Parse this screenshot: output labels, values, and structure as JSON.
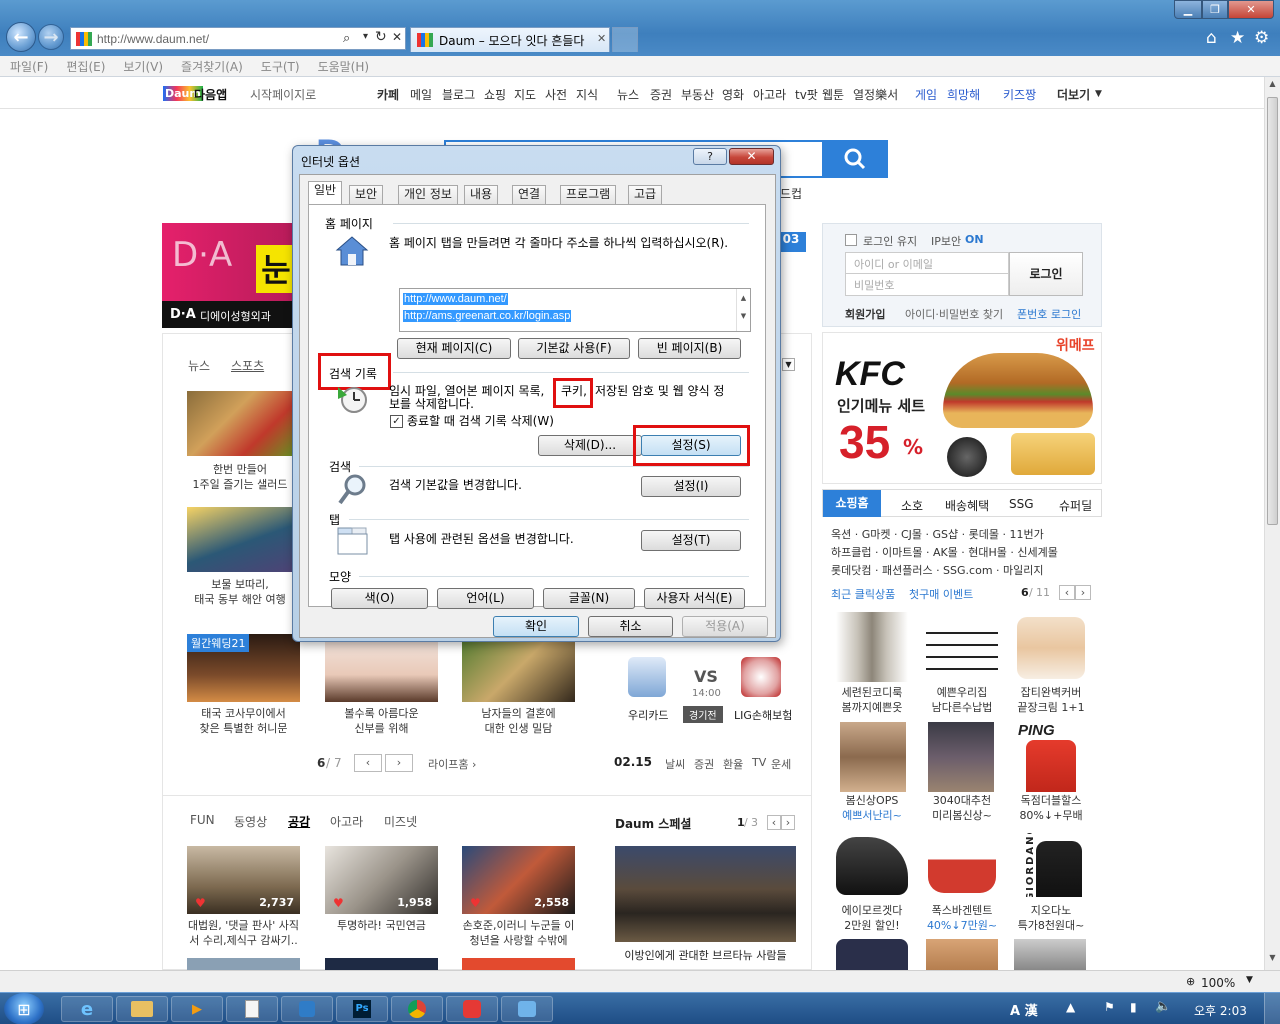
{
  "browser": {
    "address": "http://www.daum.net/",
    "tab_title": "Daum – 모으다 잇다 흔들다",
    "menu": [
      "파일(F)",
      "편집(E)",
      "보기(V)",
      "즐겨찾기(A)",
      "도구(T)",
      "도움말(H)"
    ],
    "zoom": "100%"
  },
  "gnb": {
    "logo": "Daum",
    "app": "다음앱",
    "startpage": "시작페이지로",
    "items": [
      "카페",
      "메일",
      "블로그",
      "쇼핑",
      "지도",
      "사전",
      "지식",
      "뉴스",
      "증권",
      "부동산",
      "영화",
      "아고라",
      "tv팟",
      "웹툰",
      "열정樂서"
    ],
    "items_blue": [
      "게임",
      "희망해",
      "키즈짱"
    ],
    "more": "더보기"
  },
  "login": {
    "keep": "로그인 유지",
    "ip": "IP보안",
    "ip_state": "ON",
    "id_placeholder": "아이디 or 이메일",
    "pw_placeholder": "비밀번호",
    "button": "로그인",
    "join": "회원가입",
    "find": "아이디·비밀번호 찾기",
    "phone": "폰번호 로그인"
  },
  "ad_da": {
    "logo": "D·A",
    "name": "디에이성형외과",
    "big": "눈"
  },
  "kfc": {
    "brand": "KFC",
    "line1": "인기메뉴 세트",
    "pct": "35",
    "pct_sign": "%",
    "we": "위메프"
  },
  "news_tabs": [
    "뉴스",
    "스포츠"
  ],
  "news_items": [
    {
      "cap1": "한번 만들어",
      "cap2": "1주일 즐기는 샐러드"
    },
    {
      "cap1": "보물 보따리,",
      "cap2": "태국 동부 해안 여행"
    },
    {
      "cap1": "태국 코사무이에서",
      "cap2": "찾은 특별한 허니문",
      "badge": "월간웨딩21"
    },
    {
      "cap1": "볼수록 아름다운",
      "cap2": "신부를 위해"
    },
    {
      "cap1": "남자들의 결혼에",
      "cap2": "대한 인생 밀담"
    }
  ],
  "life_pager": {
    "current": "6",
    "total": "7",
    "link": "라이프홈 ›"
  },
  "sports": {
    "team1": "우리카드",
    "vs": "VS",
    "time": "14:00",
    "state": "경기전",
    "team2": "LIG손해보험"
  },
  "date_bar": {
    "date": "02.15",
    "items": [
      "날씨",
      "증권",
      "환율",
      "TV",
      "운세"
    ]
  },
  "fun_tabs": [
    "FUN",
    "동영상",
    "공감",
    "아고라",
    "미즈넷"
  ],
  "fun_items": [
    {
      "count": "2,737",
      "cap1": "대법원, '댓글 판사' 사직",
      "cap2": "서 수리,제식구 감싸기.."
    },
    {
      "count": "1,958",
      "cap1": "투명하라! 국민연금",
      "cap2": ""
    },
    {
      "count": "2,558",
      "cap1": "손호준,이러니 누군들 이",
      "cap2": "청년을 사랑할 수밖에"
    }
  ],
  "special": {
    "title": "Daum 스페셜",
    "page": "1",
    "total": "3",
    "cap": "이방인에게 관대한 브르타뉴 사람들"
  },
  "shopping": {
    "tabs": [
      "쇼핑홈",
      "소호",
      "배송혜택",
      "SSG",
      "슈퍼딜"
    ],
    "line1": "옥션 · G마켓 · CJ몰 · GS샵 · 롯데몰 · 11번가",
    "line2": "하프클럽 · 이마트몰 · AK몰 · 현대H몰 · 신세계몰",
    "line3": "롯데닷컴 · 패션플러스 · SSG.com · 마일리지",
    "recent": "최근 클릭상품",
    "event": "첫구매 이벤트",
    "page": "6",
    "total": "11",
    "products": [
      {
        "c1": "세련된코디룩",
        "c2": "봄까지예쁜옷"
      },
      {
        "c1": "예쁜우리집",
        "c2": "남다른수납법"
      },
      {
        "c1": "잡티완벽커버",
        "c2": "끝장크림 1+1"
      },
      {
        "c1": "봄신상OPS",
        "c2": "예쁘서난리~"
      },
      {
        "c1": "3040대추천",
        "c2": "미리봄신상~"
      },
      {
        "c1": "독점더블할스",
        "c2": "80%↓+무배"
      },
      {
        "c1": "에이모르겟다",
        "c2": "2만원 할인!"
      },
      {
        "c1": "폭스바겐텐트",
        "c2": "40%↓7만원~"
      },
      {
        "c1": "지오다노",
        "c2": "특가8천원대~"
      }
    ],
    "ping": "PING",
    "giordano": "GIORDANO"
  },
  "dialog": {
    "title": "인터넷 옵션",
    "help": "?",
    "close": "✕",
    "tabs": [
      "일반",
      "보안",
      "개인 정보",
      "내용",
      "연결",
      "프로그램",
      "고급"
    ],
    "home": {
      "label": "홈 페이지",
      "desc": "홈 페이지 탭을 만들려면 각 줄마다 주소를 하나씩 입력하십시오(R).",
      "urls": [
        "http://www.daum.net/",
        "http://ams.greenart.co.kr/login.asp"
      ],
      "btn_current": "현재 페이지(C)",
      "btn_default": "기본값 사용(F)",
      "btn_blank": "빈 페이지(B)"
    },
    "history": {
      "label": "검색 기록",
      "desc_a": "임시 파일, 열어본 페이지 목록,",
      "desc_cookie": "쿠키,",
      "desc_b": "저장된 암호 및 웹 양식 정",
      "desc_c": "보를 삭제합니다.",
      "checkbox": "종료할 때 검색 기록 삭제(W)",
      "btn_delete": "삭제(D)...",
      "btn_settings": "설정(S)"
    },
    "search": {
      "label": "검색",
      "desc": "검색 기본값을 변경합니다.",
      "btn": "설정(I)"
    },
    "tabs_group": {
      "label": "탭",
      "desc": "탭 사용에 관련된 옵션을 변경합니다.",
      "btn": "설정(T)"
    },
    "appearance": {
      "label": "모양",
      "btn_color": "색(O)",
      "btn_lang": "언어(L)",
      "btn_font": "글꼴(N)",
      "btn_access": "사용자 서식(E)"
    },
    "ok": "확인",
    "cancel": "취소",
    "apply": "적용(A)"
  },
  "taskbar": {
    "time": "오후 2:03",
    "ime": "A 漢"
  },
  "colors": {
    "accent": "#2d80d9",
    "highlight": "#e01010",
    "kfc_red": "#d6202a"
  }
}
